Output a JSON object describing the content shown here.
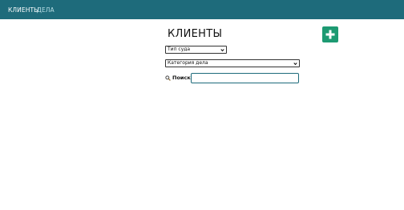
{
  "nav": {
    "items": [
      {
        "label": "КЛИЕНТЫ",
        "active": true
      },
      {
        "label": "ДЕЛА",
        "active": false
      }
    ],
    "background": "#1e6b7b"
  },
  "page": {
    "title": "КЛИЕНТЫ",
    "add_button_icon": "plus-icon",
    "add_button_color": "#1d9a72"
  },
  "filters": {
    "court_type": {
      "selected": "Тип суда"
    },
    "case_category": {
      "selected": "Категория дела"
    }
  },
  "search": {
    "icon": "search-icon",
    "label": "Поиск:",
    "value": ""
  }
}
